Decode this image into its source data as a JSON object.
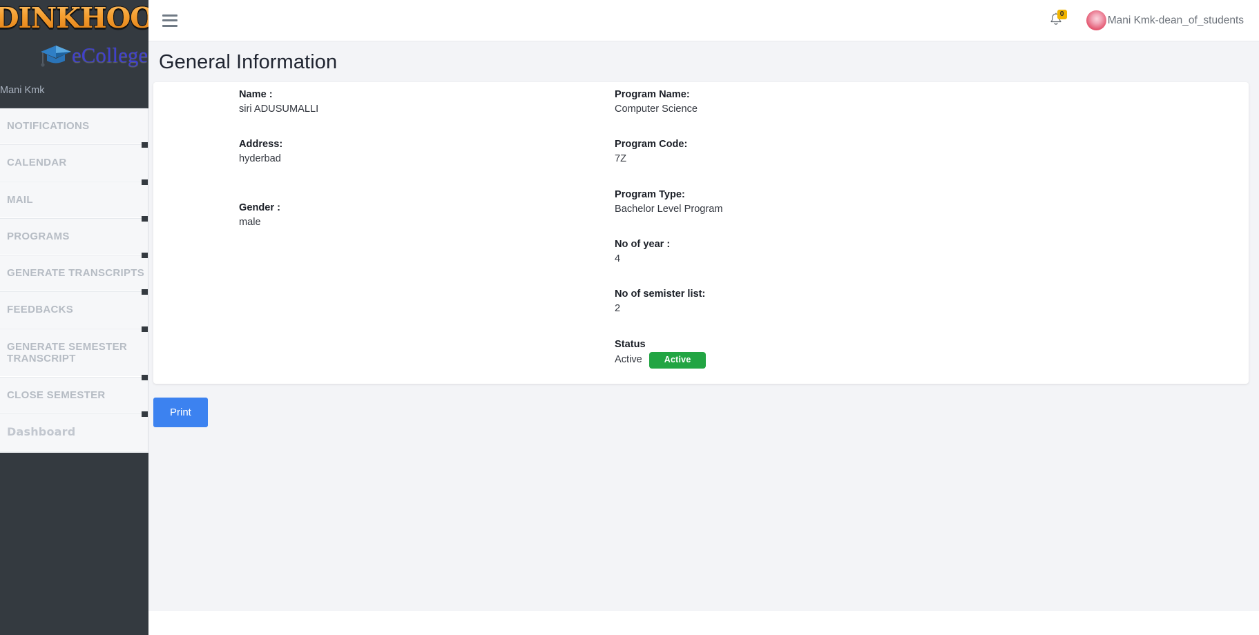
{
  "brand": {
    "logo_text": "DINKHOO!",
    "logo_sub": "eCollege",
    "logo_icon": "graduation-cap-icon",
    "user": "Mani Kmk"
  },
  "sidebar": {
    "items": [
      {
        "label": "NOTIFICATIONS",
        "style": "caps"
      },
      {
        "label": "CALENDAR",
        "style": "caps"
      },
      {
        "label": "MAIL",
        "style": "caps"
      },
      {
        "label": "PROGRAMS",
        "style": "caps"
      },
      {
        "label": "GENERATE TRANSCRIPTS",
        "style": "caps"
      },
      {
        "label": "FEEDBACKS",
        "style": "caps"
      },
      {
        "label": "GENERATE SEMESTER TRANSCRIPT",
        "style": "caps"
      },
      {
        "label": "CLOSE SEMESTER",
        "style": "caps"
      },
      {
        "label": "Dashboard",
        "style": "plain"
      }
    ]
  },
  "topbar": {
    "menu_icon": "hamburger-icon",
    "bell_icon": "bell-icon",
    "notification_count": "0",
    "avatar_icon": "user-avatar",
    "user_label": "Mani Kmk-dean_of_students"
  },
  "page": {
    "title": "General Information"
  },
  "details": {
    "left": [
      {
        "label": "Name :",
        "value": "siri ADUSUMALLI"
      },
      {
        "label": "Address:",
        "value": "hyderbad"
      },
      {
        "label": "Gender :",
        "value": "male"
      }
    ],
    "right": [
      {
        "label": "Program Name:",
        "value": "Computer Science"
      },
      {
        "label": "Program Code:",
        "value": "7Z"
      },
      {
        "label": "Program Type:",
        "value": "Bachelor Level Program"
      },
      {
        "label": "No of year :",
        "value": "4"
      },
      {
        "label": "No of semister list:",
        "value": "2"
      }
    ],
    "status": {
      "label": "Status",
      "value": "Active",
      "badge": "Active"
    }
  },
  "actions": {
    "print_label": "Print"
  },
  "colors": {
    "sidebar_bg": "#343a40",
    "nav_bg": "#f6f7f9",
    "accent_blue": "#3c82f0",
    "status_green": "#22a543",
    "badge_yellow": "#f0b400",
    "logo_orange": "#f0941e",
    "logo_blue": "#3f3fd0",
    "page_bg": "#f3f4f7"
  }
}
